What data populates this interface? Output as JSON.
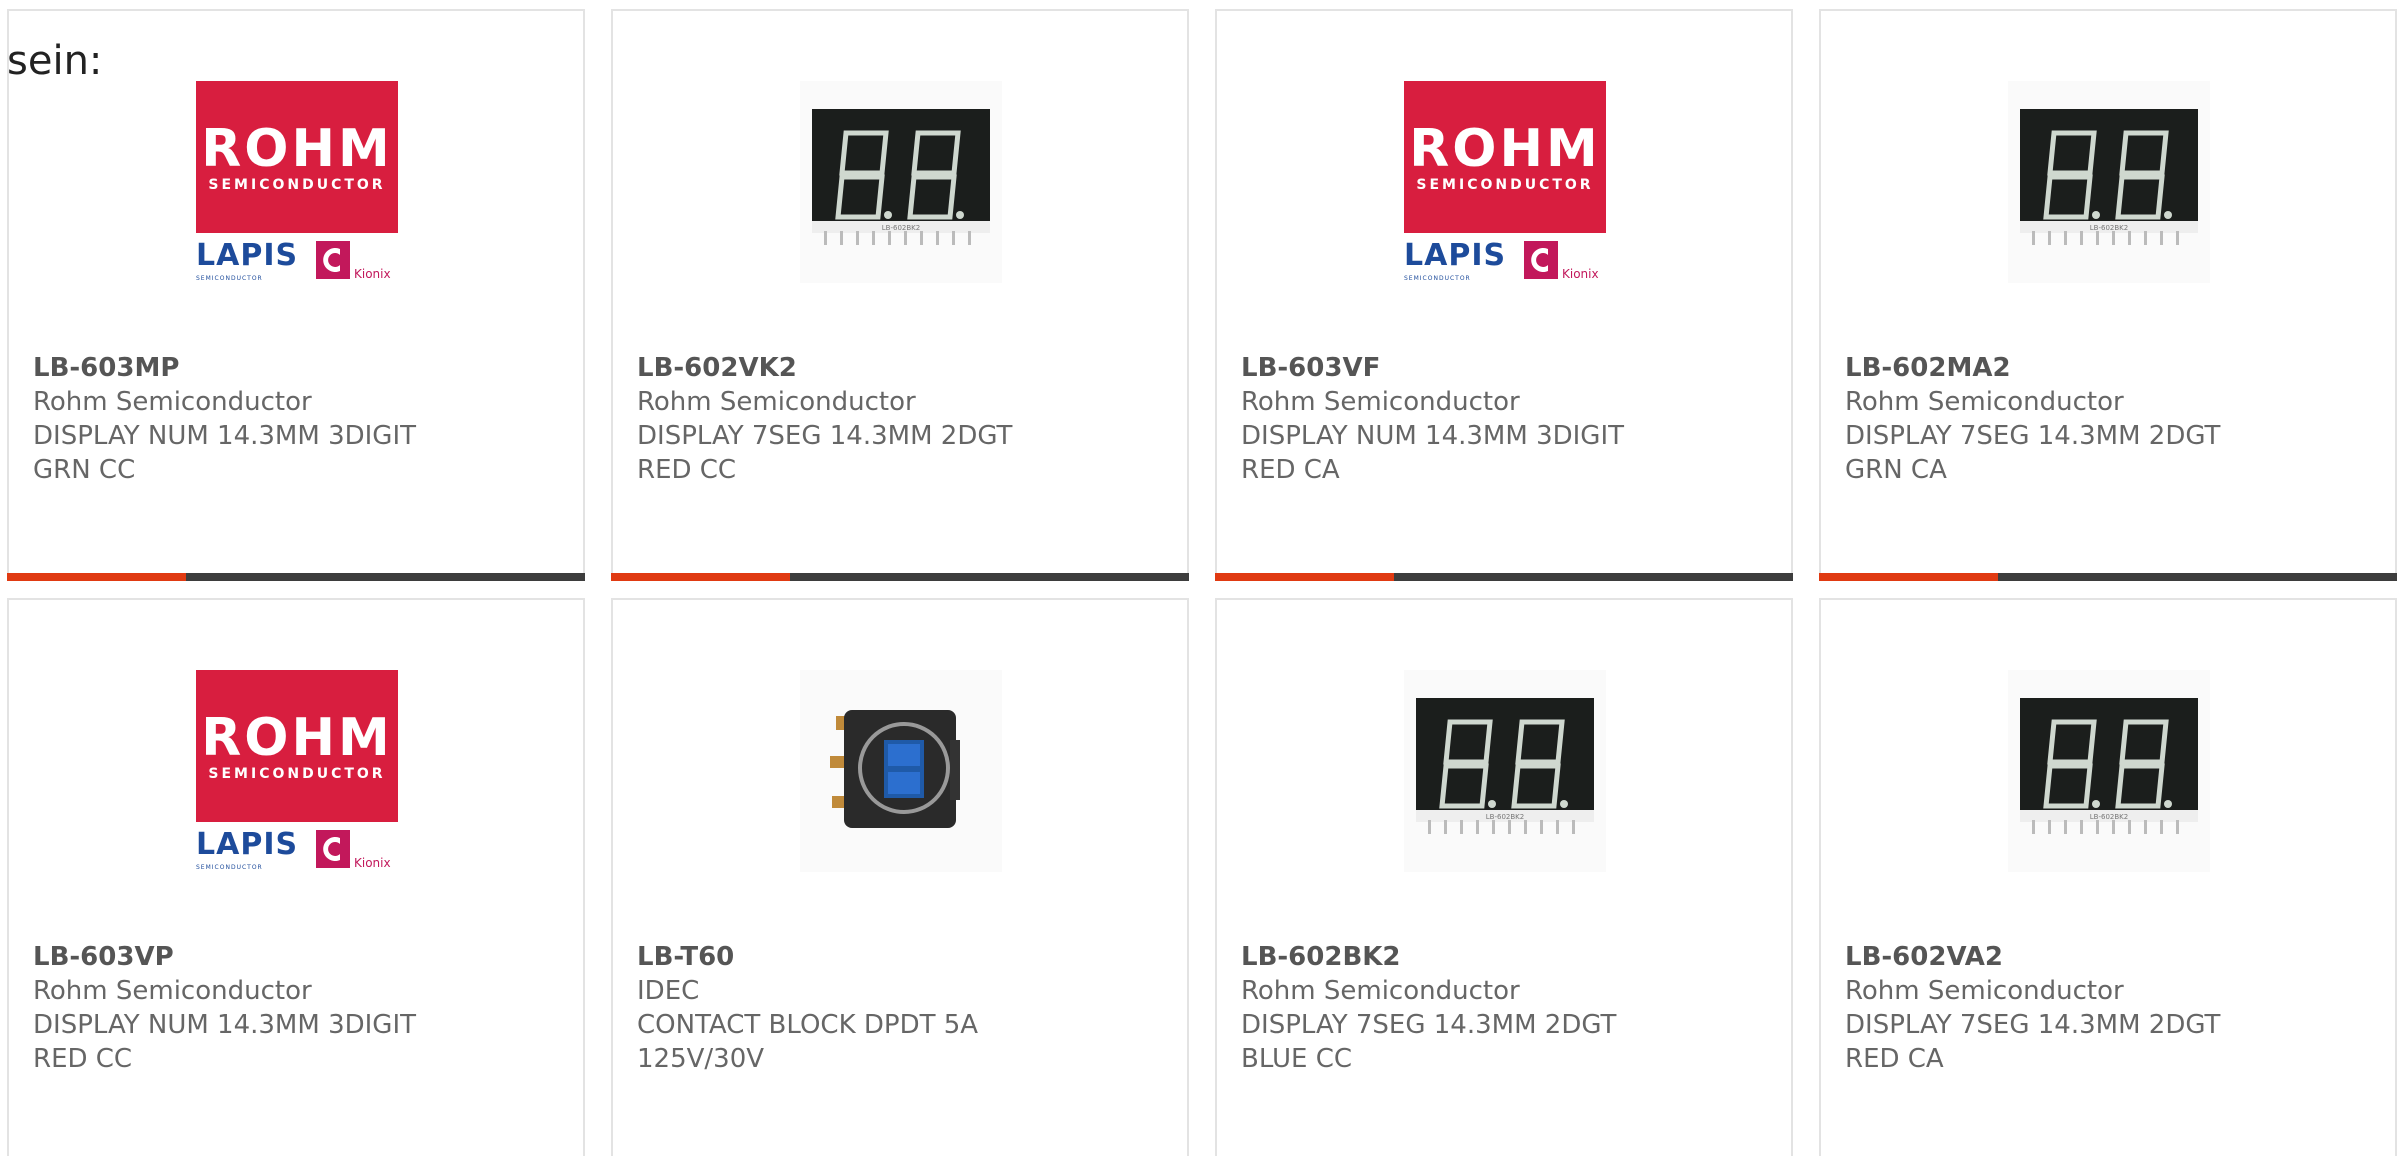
{
  "intro_text": "sein:",
  "accent_color": "#e03a12",
  "bar_color": "#3d3d3d",
  "logo": {
    "rohm_word": "ROHM",
    "rohm_semi": "SEMICONDUCTOR",
    "lapis_word": "LAPIS",
    "lapis_sub": "SEMICONDUCTOR",
    "kionix_word": "Kionix"
  },
  "seg_part_label": "LB-602BK2",
  "cards": [
    {
      "part": "LB-603MP",
      "manufacturer": "Rohm Semiconductor",
      "desc1": "DISPLAY NUM 14.3MM 3DIGIT",
      "desc2": "GRN CC",
      "image": "rohm-logo",
      "progress": 0.31
    },
    {
      "part": "LB-602VK2",
      "manufacturer": "Rohm Semiconductor",
      "desc1": "DISPLAY 7SEG 14.3MM 2DGT",
      "desc2": "RED CC",
      "image": "seven-segment-display",
      "progress": 0.31
    },
    {
      "part": "LB-603VF",
      "manufacturer": "Rohm Semiconductor",
      "desc1": "DISPLAY NUM 14.3MM 3DIGIT",
      "desc2": "RED CA",
      "image": "rohm-logo",
      "progress": 0.31
    },
    {
      "part": "LB-602MA2",
      "manufacturer": "Rohm Semiconductor",
      "desc1": "DISPLAY 7SEG 14.3MM 2DGT",
      "desc2": "GRN CA",
      "image": "seven-segment-display",
      "progress": 0.31
    },
    {
      "part": "LB-603VP",
      "manufacturer": "Rohm Semiconductor",
      "desc1": "DISPLAY NUM 14.3MM 3DIGIT",
      "desc2": "RED CC",
      "image": "rohm-logo"
    },
    {
      "part": "LB-T60",
      "manufacturer": "IDEC",
      "desc1": "CONTACT BLOCK DPDT 5A",
      "desc2": "125V/30V",
      "image": "contact-block"
    },
    {
      "part": "LB-602BK2",
      "manufacturer": "Rohm Semiconductor",
      "desc1": "DISPLAY 7SEG 14.3MM 2DGT",
      "desc2": "BLUE CC",
      "image": "seven-segment-display"
    },
    {
      "part": "LB-602VA2",
      "manufacturer": "Rohm Semiconductor",
      "desc1": "DISPLAY 7SEG 14.3MM 2DGT",
      "desc2": "RED CA",
      "image": "seven-segment-display"
    }
  ]
}
